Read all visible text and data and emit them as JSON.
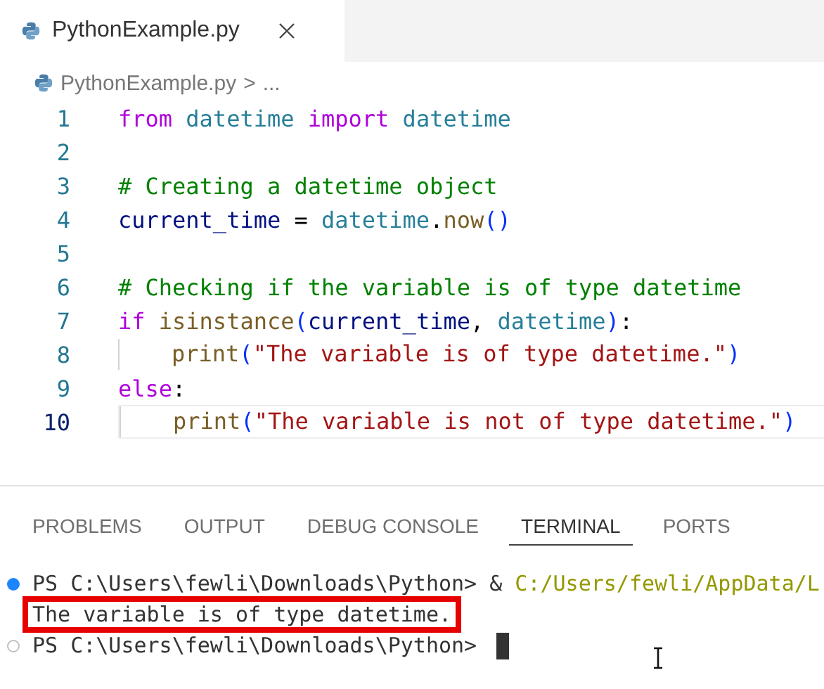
{
  "editor_tab": {
    "label": "PythonExample.py",
    "selected": true
  },
  "breadcrumb": {
    "file": "PythonExample.py",
    "separator": ">",
    "more": "..."
  },
  "code_lines": [
    {
      "number": "1",
      "current": false,
      "tokens": [
        {
          "kind": "keyword",
          "text": "from"
        },
        {
          "kind": "class",
          "text": " datetime"
        },
        {
          "kind": "keyword",
          "text": " import"
        },
        {
          "kind": "class",
          "text": " datetime"
        }
      ]
    },
    {
      "number": "2",
      "current": false
    },
    {
      "number": "3",
      "current": false,
      "tokens": [
        {
          "kind": "comment",
          "text": "# Creating a datetime object"
        }
      ]
    },
    {
      "number": "4",
      "current": false,
      "tokens": [
        {
          "kind": "variable",
          "text": "current_time"
        },
        {
          "kind": "plain",
          "text": " = "
        },
        {
          "kind": "class",
          "text": "datetime"
        },
        {
          "kind": "plain",
          "text": "."
        },
        {
          "kind": "function",
          "text": "now"
        },
        {
          "kind": "paren",
          "text": "()"
        }
      ]
    },
    {
      "number": "5",
      "current": false
    },
    {
      "number": "6",
      "current": false,
      "tokens": [
        {
          "kind": "comment",
          "text": "# Checking if the variable is of type datetime"
        }
      ]
    },
    {
      "number": "7",
      "current": false,
      "tokens": [
        {
          "kind": "keyword",
          "text": "if"
        },
        {
          "kind": "function",
          "text": " isinstance"
        },
        {
          "kind": "paren",
          "text": "("
        },
        {
          "kind": "variable",
          "text": "current_time"
        },
        {
          "kind": "plain",
          "text": ","
        },
        {
          "kind": "class",
          "text": " datetime"
        },
        {
          "kind": "paren",
          "text": ")"
        },
        {
          "kind": "plain",
          "text": ":"
        }
      ]
    },
    {
      "number": "8",
      "current": false,
      "indented": true,
      "tokens": [
        {
          "kind": "function",
          "text": "print"
        },
        {
          "kind": "paren",
          "text": "("
        },
        {
          "kind": "string",
          "text": "\"The variable is of type datetime.\""
        },
        {
          "kind": "paren",
          "text": ")"
        }
      ]
    },
    {
      "number": "9",
      "current": false,
      "tokens": [
        {
          "kind": "keyword",
          "text": "else"
        },
        {
          "kind": "plain",
          "text": ":"
        }
      ]
    },
    {
      "number": "10",
      "current": true,
      "indented": true,
      "tokens": [
        {
          "kind": "function",
          "text": "print"
        },
        {
          "kind": "paren",
          "text": "("
        },
        {
          "kind": "string",
          "text": "\"The variable is not of type datetime.\""
        },
        {
          "kind": "paren",
          "text": ")"
        }
      ]
    }
  ],
  "panel_tabs": [
    {
      "label": "PROBLEMS",
      "selected": false
    },
    {
      "label": "OUTPUT",
      "selected": false
    },
    {
      "label": "DEBUG CONSOLE",
      "selected": false
    },
    {
      "label": "TERMINAL",
      "selected": true
    },
    {
      "label": "PORTS",
      "selected": false
    }
  ],
  "terminal_lines": [
    {
      "kind": "command",
      "succeeded": true,
      "highlighted": false,
      "segments": [
        {
          "kind": "plain",
          "text": "PS C:\\Users\\fewli\\Downloads\\Python> &"
        },
        {
          "kind": "path",
          "text": " C:/Users/fewli/AppData/L"
        }
      ]
    },
    {
      "kind": "output",
      "highlighted": true,
      "segments": [
        {
          "kind": "plain",
          "text": "The variable is of type datetime."
        }
      ]
    },
    {
      "kind": "command",
      "succeeded": false,
      "highlighted": false,
      "cursor": true,
      "segments": [
        {
          "kind": "plain",
          "text": "PS C:\\Users\\fewli\\Downloads\\Python>"
        }
      ]
    }
  ]
}
